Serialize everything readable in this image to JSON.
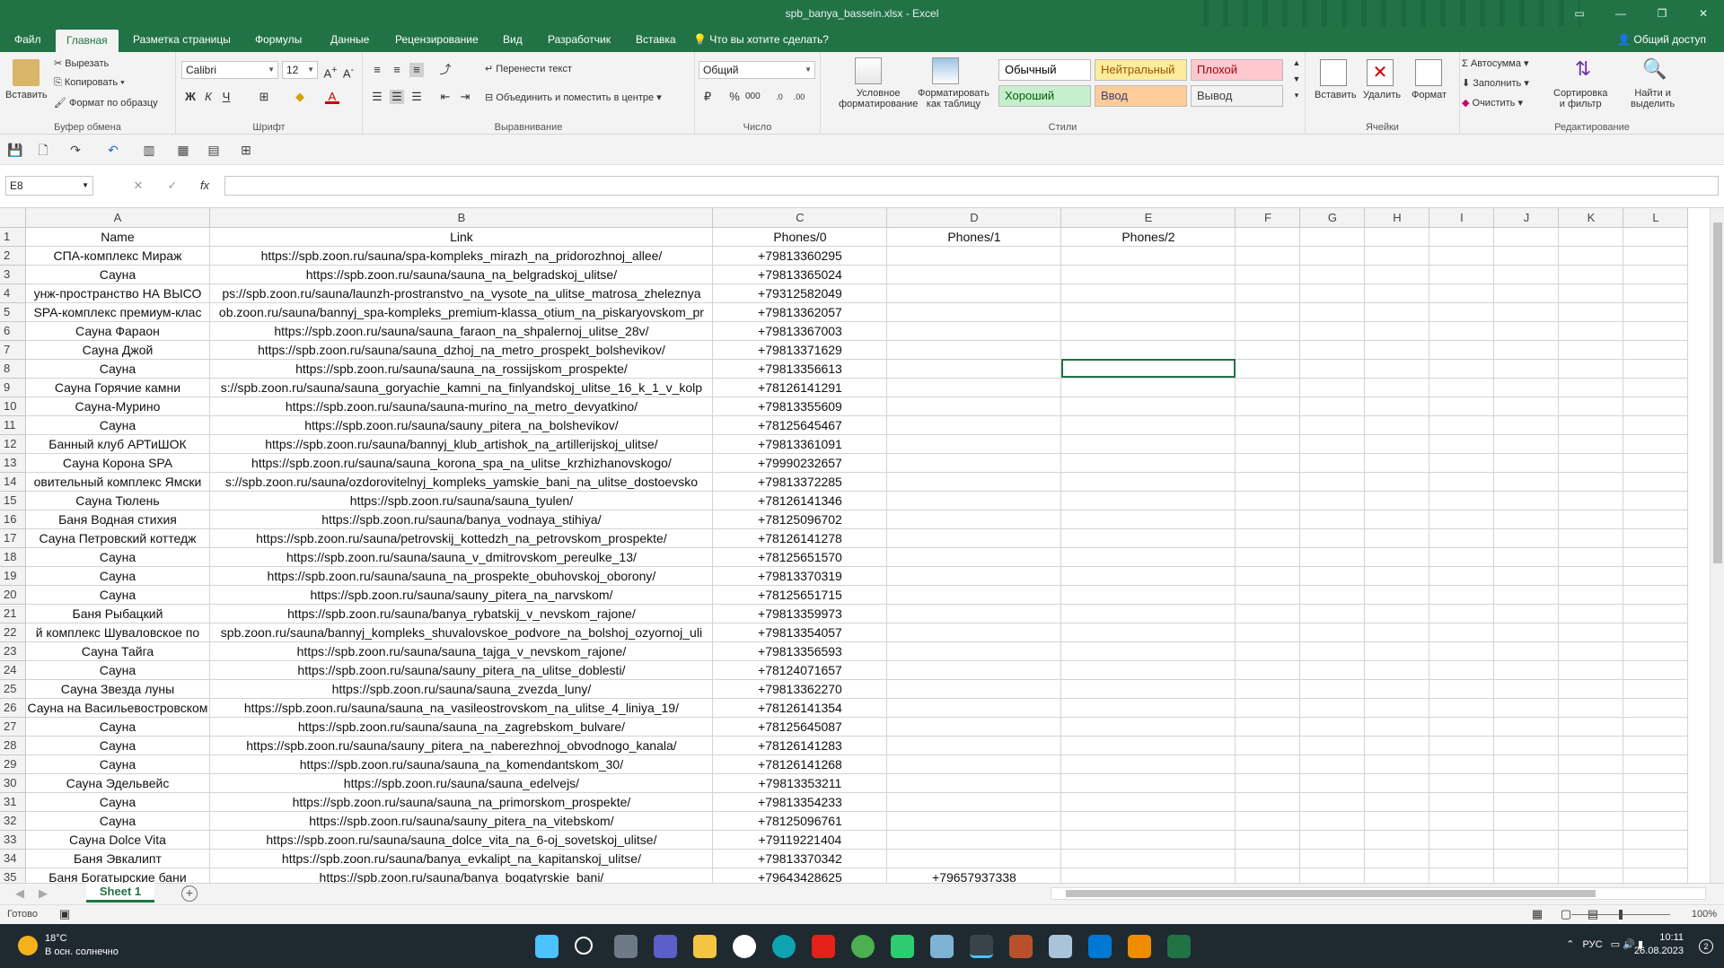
{
  "window": {
    "title": "spb_banya_bassein.xlsx - Excel"
  },
  "tabs": [
    "Файл",
    "Главная",
    "Разметка страницы",
    "Формулы",
    "Данные",
    "Рецензирование",
    "Вид",
    "Разработчик",
    "Вставка"
  ],
  "tell_me": "Что вы хотите сделать?",
  "share": "Общий доступ",
  "ribbon": {
    "clipboard": {
      "paste": "Вставить",
      "cut": "Вырезать",
      "copy": "Копировать",
      "format_painter": "Формат по образцу",
      "label": "Буфер обмена"
    },
    "font": {
      "name": "Calibri",
      "size": "12",
      "label": "Шрифт"
    },
    "alignment": {
      "wrap": "Перенести текст",
      "merge": "Объединить и поместить в центре",
      "label": "Выравнивание"
    },
    "number": {
      "format": "Общий",
      "label": "Число"
    },
    "styles": {
      "conditional": [
        "Условное",
        "форматирование"
      ],
      "as_table": [
        "Форматировать",
        "как таблицу"
      ],
      "cells": [
        {
          "text": "Обычный",
          "bg": "#ffffff",
          "color": "#000000"
        },
        {
          "text": "Нейтральный",
          "bg": "#ffeb9c",
          "color": "#9c5700"
        },
        {
          "text": "Плохой",
          "bg": "#ffc7ce",
          "color": "#9c0006"
        },
        {
          "text": "Хороший",
          "bg": "#c6efce",
          "color": "#006100"
        },
        {
          "text": "Ввод",
          "bg": "#ffcc99",
          "color": "#3f3f76"
        },
        {
          "text": "Вывод",
          "bg": "#f2f2f2",
          "color": "#3f3f3f"
        }
      ],
      "label": "Стили"
    },
    "cells": {
      "insert": "Вставить",
      "delete": "Удалить",
      "format": "Формат",
      "label": "Ячейки"
    },
    "editing": {
      "autosum": "Автосумма",
      "fill": "Заполнить",
      "clear": "Очистить",
      "sort": [
        "Сортировка",
        "и фильтр"
      ],
      "find": [
        "Найти и",
        "выделить"
      ],
      "label": "Редактирование"
    }
  },
  "formula_bar": {
    "name_box": "E8",
    "fx": "fx",
    "value": ""
  },
  "columns": [
    "A",
    "B",
    "C",
    "D",
    "E",
    "F",
    "G",
    "H",
    "I",
    "J",
    "K",
    "L"
  ],
  "rows": [
    [
      "Name",
      "Link",
      "Phones/0",
      "Phones/1",
      "Phones/2"
    ],
    [
      "СПА-комплекс Мираж",
      "https://spb.zoon.ru/sauna/spa-kompleks_mirazh_na_pridorozhnoj_allee/",
      "+79813360295",
      "",
      ""
    ],
    [
      "Сауна",
      "https://spb.zoon.ru/sauna/sauna_na_belgradskoj_ulitse/",
      "+79813365024",
      "",
      ""
    ],
    [
      "унж-пространство НА ВЫСО",
      "ps://spb.zoon.ru/sauna/launzh-prostranstvo_na_vysote_na_ulitse_matrosa_zheleznya",
      "+79312582049",
      "",
      ""
    ],
    [
      "SPA-комплекс премиум-клас",
      "ob.zoon.ru/sauna/bannyj_spa-kompleks_premium-klassa_otium_na_piskaryovskom_pr",
      "+79813362057",
      "",
      ""
    ],
    [
      "Сауна Фараон",
      "https://spb.zoon.ru/sauna/sauna_faraon_na_shpalernoj_ulitse_28v/",
      "+79813367003",
      "",
      ""
    ],
    [
      "Сауна Джой",
      "https://spb.zoon.ru/sauna/sauna_dzhoj_na_metro_prospekt_bolshevikov/",
      "+79813371629",
      "",
      ""
    ],
    [
      "Сауна",
      "https://spb.zoon.ru/sauna/sauna_na_rossijskom_prospekte/",
      "+79813356613",
      "",
      ""
    ],
    [
      "Сауна Горячие камни",
      "s://spb.zoon.ru/sauna/sauna_goryachie_kamni_na_finlyandskoj_ulitse_16_k_1_v_kolp",
      "+78126141291",
      "",
      ""
    ],
    [
      "Сауна-Мурино",
      "https://spb.zoon.ru/sauna/sauna-murino_na_metro_devyatkino/",
      "+79813355609",
      "",
      ""
    ],
    [
      "Сауна",
      "https://spb.zoon.ru/sauna/sauny_pitera_na_bolshevikov/",
      "+78125645467",
      "",
      ""
    ],
    [
      "Банный клуб АРТиШОК",
      "https://spb.zoon.ru/sauna/bannyj_klub_artishok_na_artillerijskoj_ulitse/",
      "+79813361091",
      "",
      ""
    ],
    [
      "Сауна Корона SPA",
      "https://spb.zoon.ru/sauna/sauna_korona_spa_na_ulitse_krzhizhanovskogo/",
      "+79990232657",
      "",
      ""
    ],
    [
      "овительный комплекс Ямски",
      "s://spb.zoon.ru/sauna/ozdorovitelnyj_kompleks_yamskie_bani_na_ulitse_dostoevsko",
      "+79813372285",
      "",
      ""
    ],
    [
      "Сауна Тюлень",
      "https://spb.zoon.ru/sauna/sauna_tyulen/",
      "+78126141346",
      "",
      ""
    ],
    [
      "Баня Водная стихия",
      "https://spb.zoon.ru/sauna/banya_vodnaya_stihiya/",
      "+78125096702",
      "",
      ""
    ],
    [
      "Сауна Петровский коттедж",
      "https://spb.zoon.ru/sauna/petrovskij_kottedzh_na_petrovskom_prospekte/",
      "+78126141278",
      "",
      ""
    ],
    [
      "Сауна",
      "https://spb.zoon.ru/sauna/sauna_v_dmitrovskom_pereulke_13/",
      "+78125651570",
      "",
      ""
    ],
    [
      "Сауна",
      "https://spb.zoon.ru/sauna/sauna_na_prospekte_obuhovskoj_oborony/",
      "+79813370319",
      "",
      ""
    ],
    [
      "Сауна",
      "https://spb.zoon.ru/sauna/sauny_pitera_na_narvskom/",
      "+78125651715",
      "",
      ""
    ],
    [
      "Баня Рыбацкий",
      "https://spb.zoon.ru/sauna/banya_rybatskij_v_nevskom_rajone/",
      "+79813359973",
      "",
      ""
    ],
    [
      "й комплекс Шуваловское по",
      "spb.zoon.ru/sauna/bannyj_kompleks_shuvalovskoe_podvore_na_bolshoj_ozyornoj_uli",
      "+79813354057",
      "",
      ""
    ],
    [
      "Сауна Тайга",
      "https://spb.zoon.ru/sauna/sauna_tajga_v_nevskom_rajone/",
      "+79813356593",
      "",
      ""
    ],
    [
      "Сауна",
      "https://spb.zoon.ru/sauna/sauny_pitera_na_ulitse_doblesti/",
      "+78124071657",
      "",
      ""
    ],
    [
      "Сауна Звезда луны",
      "https://spb.zoon.ru/sauna/sauna_zvezda_luny/",
      "+79813362270",
      "",
      ""
    ],
    [
      "Сауна на Васильевостровском",
      "https://spb.zoon.ru/sauna/sauna_na_vasileostrovskom_na_ulitse_4_liniya_19/",
      "+78126141354",
      "",
      ""
    ],
    [
      "Сауна",
      "https://spb.zoon.ru/sauna/sauna_na_zagrebskom_bulvare/",
      "+78125645087",
      "",
      ""
    ],
    [
      "Сауна",
      "https://spb.zoon.ru/sauna/sauny_pitera_na_naberezhnoj_obvodnogo_kanala/",
      "+78126141283",
      "",
      ""
    ],
    [
      "Сауна",
      "https://spb.zoon.ru/sauna/sauna_na_komendantskom_30/",
      "+78126141268",
      "",
      ""
    ],
    [
      "Сауна Эдельвейс",
      "https://spb.zoon.ru/sauna/sauna_edelvejs/",
      "+79813353211",
      "",
      ""
    ],
    [
      "Сауна",
      "https://spb.zoon.ru/sauna/sauna_na_primorskom_prospekte/",
      "+79813354233",
      "",
      ""
    ],
    [
      "Сауна",
      "https://spb.zoon.ru/sauna/sauny_pitera_na_vitebskom/",
      "+78125096761",
      "",
      ""
    ],
    [
      "Сауна Dolce Vita",
      "https://spb.zoon.ru/sauna/sauna_dolce_vita_na_6-oj_sovetskoj_ulitse/",
      "+79119221404",
      "",
      ""
    ],
    [
      "Баня Эвкалипт",
      "https://spb.zoon.ru/sauna/banya_evkalipt_na_kapitanskoj_ulitse/",
      "+79813370342",
      "",
      ""
    ],
    [
      "Баня Богатырские бани",
      "https://spb.zoon.ru/sauna/banya_bogatyrskie_bani/",
      "+79643428625",
      "+79657937338",
      ""
    ]
  ],
  "sheet_tab": "Sheet 1",
  "status": {
    "ready": "Готово",
    "zoom": "100%"
  },
  "taskbar": {
    "temp": "18°C",
    "weather": "В осн. солнечно",
    "lang": "РУС",
    "time": "10:11",
    "date": "26.08.2023",
    "notifications": "2"
  }
}
